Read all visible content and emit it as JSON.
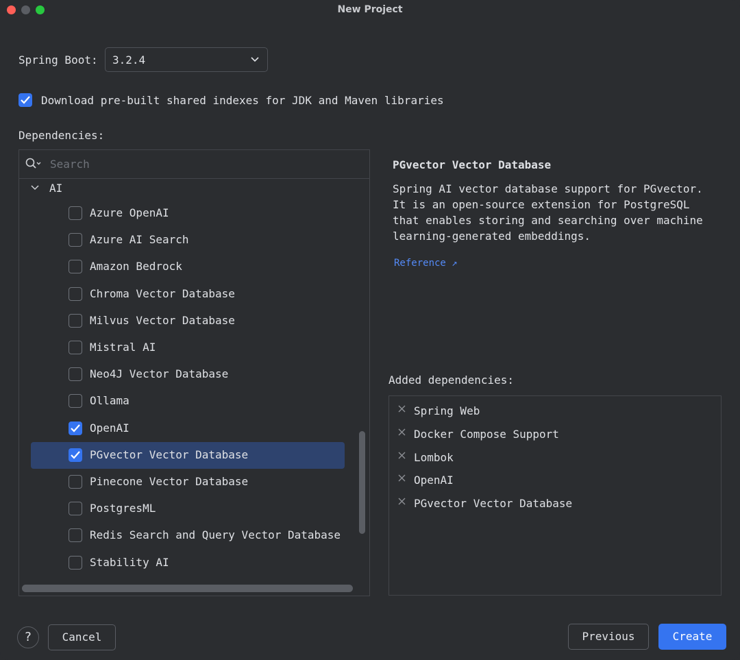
{
  "window": {
    "title": "New Project"
  },
  "spring_boot": {
    "label": "Spring Boot:",
    "value": "3.2.4"
  },
  "download_indexes": {
    "checked": true,
    "label": "Download pre-built shared indexes for JDK and Maven libraries"
  },
  "dependencies": {
    "label": "Dependencies:",
    "search_placeholder": "Search",
    "group": "AI",
    "items": [
      {
        "label": "Azure OpenAI",
        "checked": false,
        "selected": false
      },
      {
        "label": "Azure AI Search",
        "checked": false,
        "selected": false
      },
      {
        "label": "Amazon Bedrock",
        "checked": false,
        "selected": false
      },
      {
        "label": "Chroma Vector Database",
        "checked": false,
        "selected": false
      },
      {
        "label": "Milvus Vector Database",
        "checked": false,
        "selected": false
      },
      {
        "label": "Mistral AI",
        "checked": false,
        "selected": false
      },
      {
        "label": "Neo4J Vector Database",
        "checked": false,
        "selected": false
      },
      {
        "label": "Ollama",
        "checked": false,
        "selected": false
      },
      {
        "label": "OpenAI",
        "checked": true,
        "selected": false
      },
      {
        "label": "PGvector Vector Database",
        "checked": true,
        "selected": true
      },
      {
        "label": "Pinecone Vector Database",
        "checked": false,
        "selected": false
      },
      {
        "label": "PostgresML",
        "checked": false,
        "selected": false
      },
      {
        "label": "Redis Search and Query Vector Database",
        "checked": false,
        "selected": false
      },
      {
        "label": "Stability AI",
        "checked": false,
        "selected": false
      }
    ]
  },
  "description": {
    "title": "PGvector Vector Database",
    "body": "Spring AI vector database support for PGvector.\nIt is an open-source extension for PostgreSQL\nthat enables storing and searching over machine\nlearning-generated embeddings.",
    "reference_label": "Reference ↗"
  },
  "added": {
    "label": "Added dependencies:",
    "items": [
      "Spring Web",
      "Docker Compose Support",
      "Lombok",
      "OpenAI",
      "PGvector Vector Database"
    ]
  },
  "buttons": {
    "help": "?",
    "cancel": "Cancel",
    "previous": "Previous",
    "create": "Create"
  },
  "colors": {
    "accent": "#3574f0",
    "selection": "#2e436e",
    "link": "#548af7",
    "background": "#2b2d30"
  }
}
